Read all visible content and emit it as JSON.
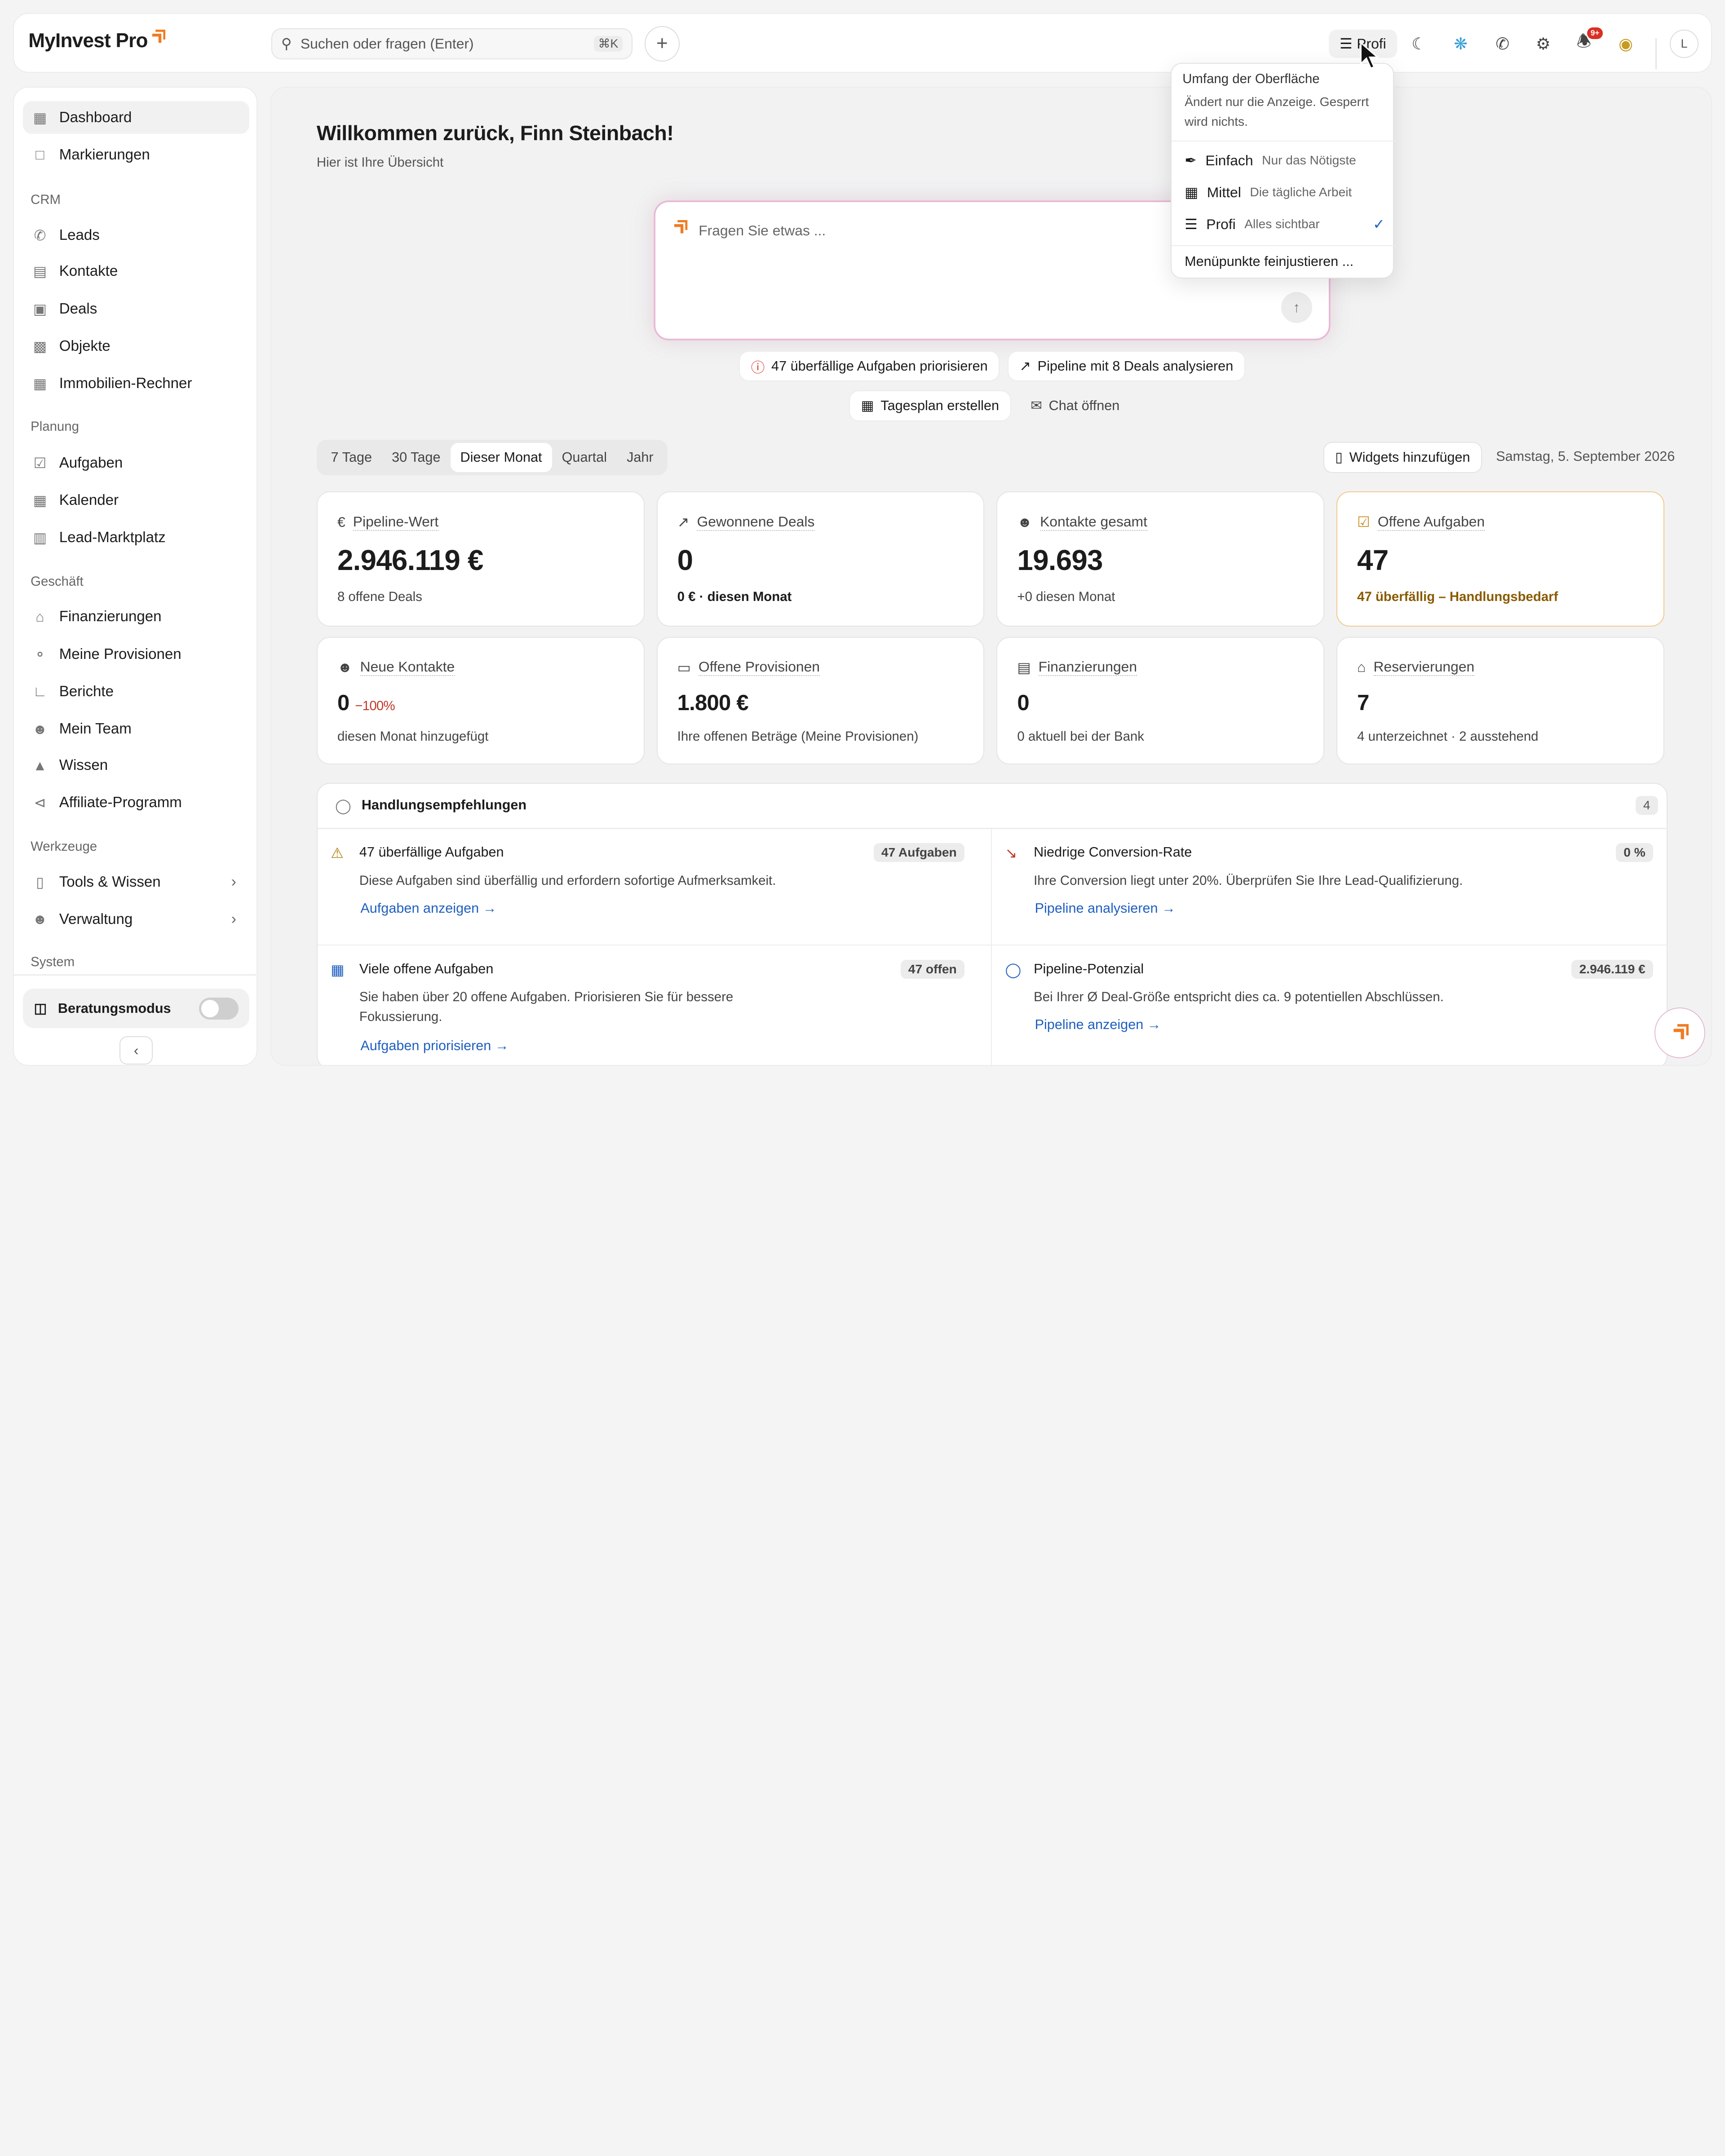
{
  "header": {
    "logo": "MyInvest Pro",
    "search_placeholder": "Suchen oder fragen (Enter)",
    "search_shortcut": "⌘K",
    "level_label": "Profi",
    "notification_badge": "9+",
    "avatar_initial": "L",
    "colors": {
      "accent": "#f07b21",
      "link": "#1f5fbf",
      "badge": "#d93025"
    }
  },
  "sidebar": {
    "top_items": [
      {
        "label": "Dashboard",
        "icon": "dashboard-icon"
      },
      {
        "label": "Markierungen",
        "icon": "bookmark-icon"
      }
    ],
    "sections": [
      {
        "title": "CRM",
        "items": [
          "Leads",
          "Kontakte",
          "Deals",
          "Objekte",
          "Immobilien-Rechner"
        ]
      },
      {
        "title": "Planung",
        "items": [
          "Aufgaben",
          "Kalender",
          "Lead-Marktplatz"
        ]
      },
      {
        "title": "Geschäft",
        "items": [
          "Finanzierungen",
          "Meine Provisionen",
          "Berichte",
          "Mein Team",
          "Wissen",
          "Affiliate-Programm"
        ]
      },
      {
        "title": "Werkzeuge",
        "items": [
          "Tools & Wissen",
          "Verwaltung"
        ]
      },
      {
        "title": "System",
        "items": []
      }
    ],
    "consult_mode": "Beratungsmodus"
  },
  "main": {
    "welcome": "Willkommen zurück, Finn Steinbach!",
    "subtitle": "Hier ist Ihre Übersicht",
    "ask_placeholder": "Fragen Sie etwas ...",
    "chips": [
      "47 überfällige Aufgaben priorisieren",
      "Pipeline mit 8 Deals analysieren",
      "Tagesplan erstellen",
      "Chat öffnen"
    ],
    "ranges": [
      "7 Tage",
      "30 Tage",
      "Dieser Monat",
      "Quartal",
      "Jahr"
    ],
    "selected_range": "Dieser Monat",
    "widgets_button": "Widgets hinzufügen",
    "date": "Samstag, 5. September 2026",
    "cards": [
      {
        "label": "Pipeline-Wert",
        "value": "2.946.119 €",
        "note": "8 offene Deals"
      },
      {
        "label": "Gewonnene Deals",
        "value": "0",
        "note": "0 € · diesen Monat"
      },
      {
        "label": "Kontakte gesamt",
        "value": "19.693",
        "note": "+0 diesen Monat"
      },
      {
        "label": "Offene Aufgaben",
        "value": "47",
        "note": "47 überfällig – Handlungsbedarf"
      },
      {
        "label": "Neue Kontakte",
        "value": "0",
        "delta": "−100%",
        "note": "diesen Monat hinzugefügt"
      },
      {
        "label": "Offene Provisionen",
        "value": "1.800 €",
        "note": "Ihre offenen Beträge (Meine Provisionen)"
      },
      {
        "label": "Finanzierungen",
        "value": "0",
        "note": "0 aktuell bei der Bank"
      },
      {
        "label": "Reservierungen",
        "value": "7",
        "note": "4 unterzeichnet · 2 ausstehend"
      }
    ],
    "recommendations": {
      "title": "Handlungsempfehlungen",
      "count": "4",
      "items": [
        {
          "title": "47 überfällige Aufgaben",
          "pill": "47 Aufgaben",
          "desc": "Diese Aufgaben sind überfällig und erfordern sofortige Aufmerksamkeit.",
          "action": "Aufgaben anzeigen"
        },
        {
          "title": "Niedrige Conversion-Rate",
          "pill": "0 %",
          "desc": "Ihre Conversion liegt unter 20%. Überprüfen Sie Ihre Lead-Qualifizierung.",
          "action": "Pipeline analysieren"
        },
        {
          "title": "Viele offene Aufgaben",
          "pill": "47 offen",
          "desc": "Sie haben über 20 offene Aufgaben. Priorisieren Sie für bessere Fokussierung.",
          "action": "Aufgaben priorisieren"
        },
        {
          "title": "Pipeline-Potenzial",
          "pill": "2.946.119 €",
          "desc": "Bei Ihrer Ø Deal-Größe entspricht dies ca. 9 potentiellen Abschlüssen.",
          "action": "Pipeline anzeigen"
        }
      ]
    }
  },
  "dropdown": {
    "title": "Umfang der Oberfläche",
    "desc": "Ändert nur die Anzeige. Gesperrt wird nichts.",
    "options": [
      {
        "label": "Einfach",
        "hint": "Nur das Nötigste"
      },
      {
        "label": "Mittel",
        "hint": "Die tägliche Arbeit"
      },
      {
        "label": "Profi",
        "hint": "Alles sichtbar"
      }
    ],
    "selected": "Profi",
    "fine_tune": "Menüpunkte feinjustieren ..."
  }
}
